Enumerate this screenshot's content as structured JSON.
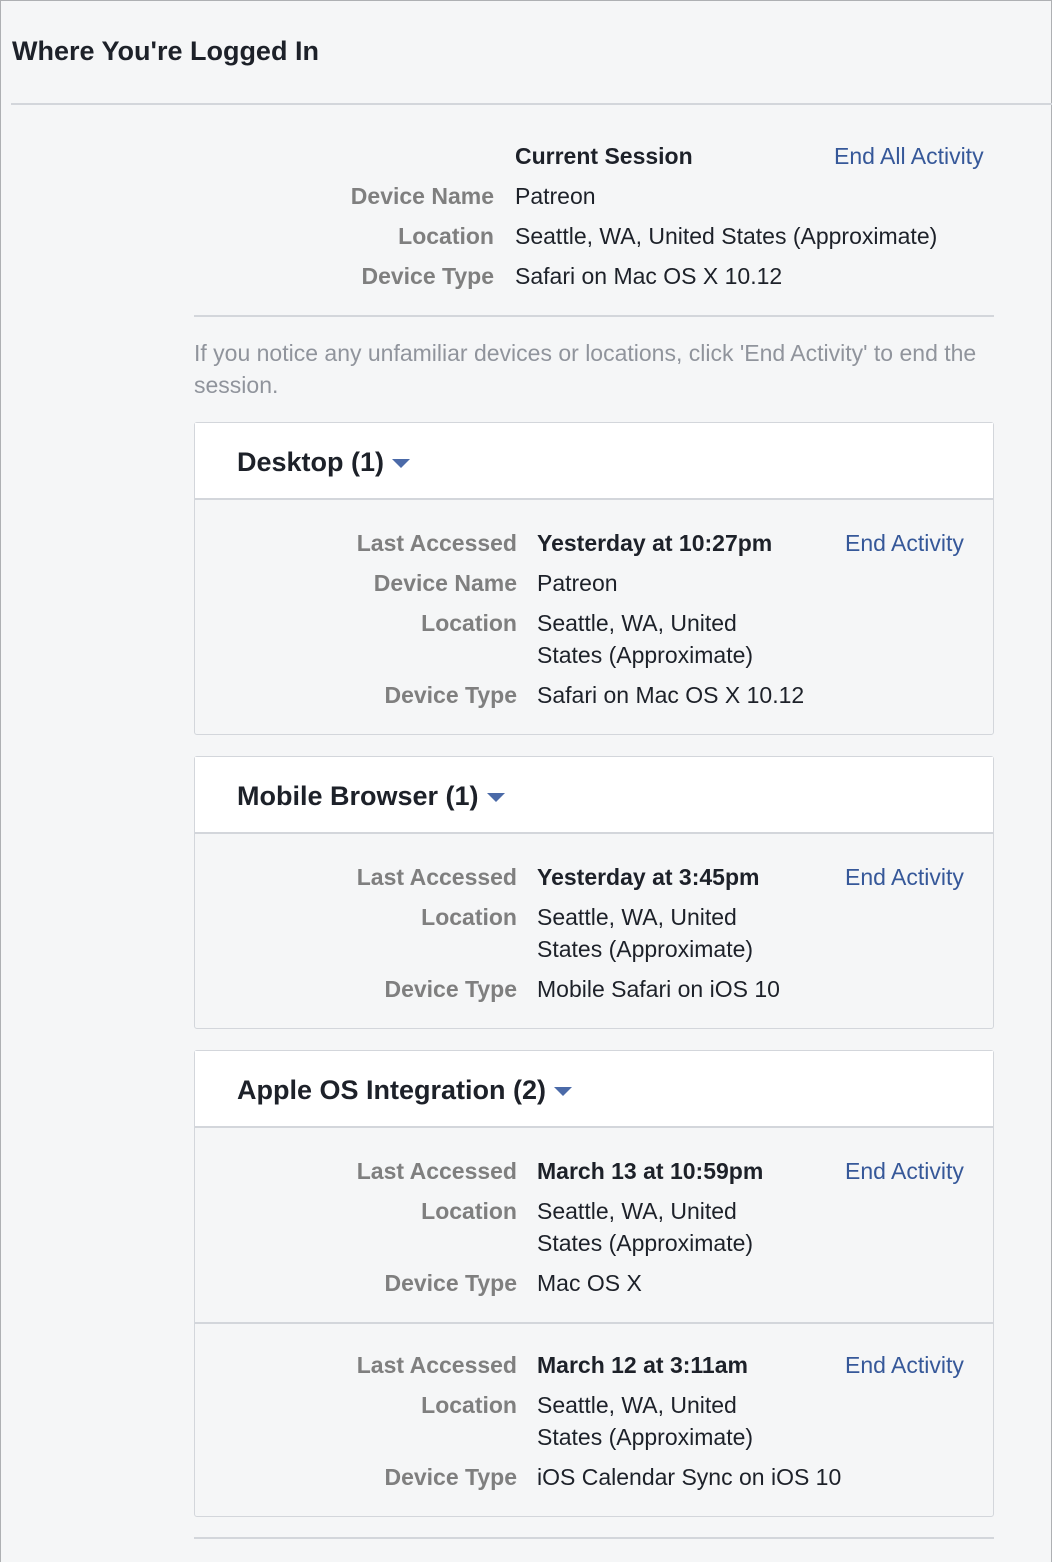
{
  "page": {
    "title": "Where You're Logged In"
  },
  "current_session": {
    "heading": "Current Session",
    "end_all_label": "End All Activity",
    "device_name_label": "Device Name",
    "device_name": "Patreon",
    "location_label": "Location",
    "location": "Seattle, WA, United States (Approximate)",
    "device_type_label": "Device Type",
    "device_type": "Safari on Mac OS X 10.12"
  },
  "notice": "If you notice any unfamiliar devices or locations, click 'End Activity' to end the session.",
  "labels": {
    "last_accessed": "Last Accessed",
    "device_name": "Device Name",
    "location": "Location",
    "device_type": "Device Type",
    "end_activity": "End Activity"
  },
  "groups": [
    {
      "title": "Desktop (1)",
      "sessions": [
        {
          "last_accessed": "Yesterday at 10:27pm",
          "device_name": "Patreon",
          "location_line1": "Seattle, WA, United",
          "location_line2": "States (Approximate)",
          "device_type": "Safari on Mac OS X 10.12"
        }
      ]
    },
    {
      "title": "Mobile Browser (1)",
      "sessions": [
        {
          "last_accessed": "Yesterday at 3:45pm",
          "location_line1": "Seattle, WA, United",
          "location_line2": "States (Approximate)",
          "device_type": "Mobile Safari on iOS 10"
        }
      ]
    },
    {
      "title": "Apple OS Integration (2)",
      "sessions": [
        {
          "last_accessed": "March 13 at 10:59pm",
          "location_line1": "Seattle, WA, United",
          "location_line2": "States (Approximate)",
          "device_type": "Mac OS X"
        },
        {
          "last_accessed": "March 12 at 3:11am",
          "location_line1": "Seattle, WA, United",
          "location_line2": "States (Approximate)",
          "device_type": "iOS Calendar Sync on iOS 10"
        }
      ]
    }
  ],
  "colors": {
    "link": "#365899",
    "label": "#7f7f7f",
    "text": "#1d2129",
    "muted": "#90949c",
    "divider": "#d3d6db",
    "background": "#f5f6f7",
    "card_header": "#ffffff"
  }
}
